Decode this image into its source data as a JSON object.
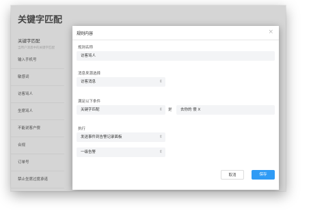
{
  "app": {
    "title": "关键字匹配"
  },
  "sidebar": {
    "header": "关键字匹配",
    "description": "当用户消息中的关键字匹配",
    "items": [
      {
        "label": "输入手机号"
      },
      {
        "label": "敏感词"
      },
      {
        "label": "访客骂人"
      },
      {
        "label": "坐席骂人"
      },
      {
        "label": "不能说客户傻"
      },
      {
        "label": "合规"
      },
      {
        "label": "订单号"
      },
      {
        "label": "禁止坐席过度承诺"
      }
    ]
  },
  "dialog": {
    "title": "规则内容",
    "close_icon": "close-icon",
    "rule_name_label": "规则名称",
    "rule_name_value": "访客骂人",
    "source_label": "消息来源选择",
    "source_value": "访客消息",
    "condition_label": "满足以下条件",
    "condition_type": "关键字匹配",
    "condition_operator": "是",
    "condition_value": "去你的 傻 X",
    "execute_label": "执行",
    "action_value": "发送事件到告警记录面板",
    "level_value": "一级告警",
    "cancel_label": "取消",
    "save_label": "保存",
    "accent_color": "#2f9bf5"
  }
}
